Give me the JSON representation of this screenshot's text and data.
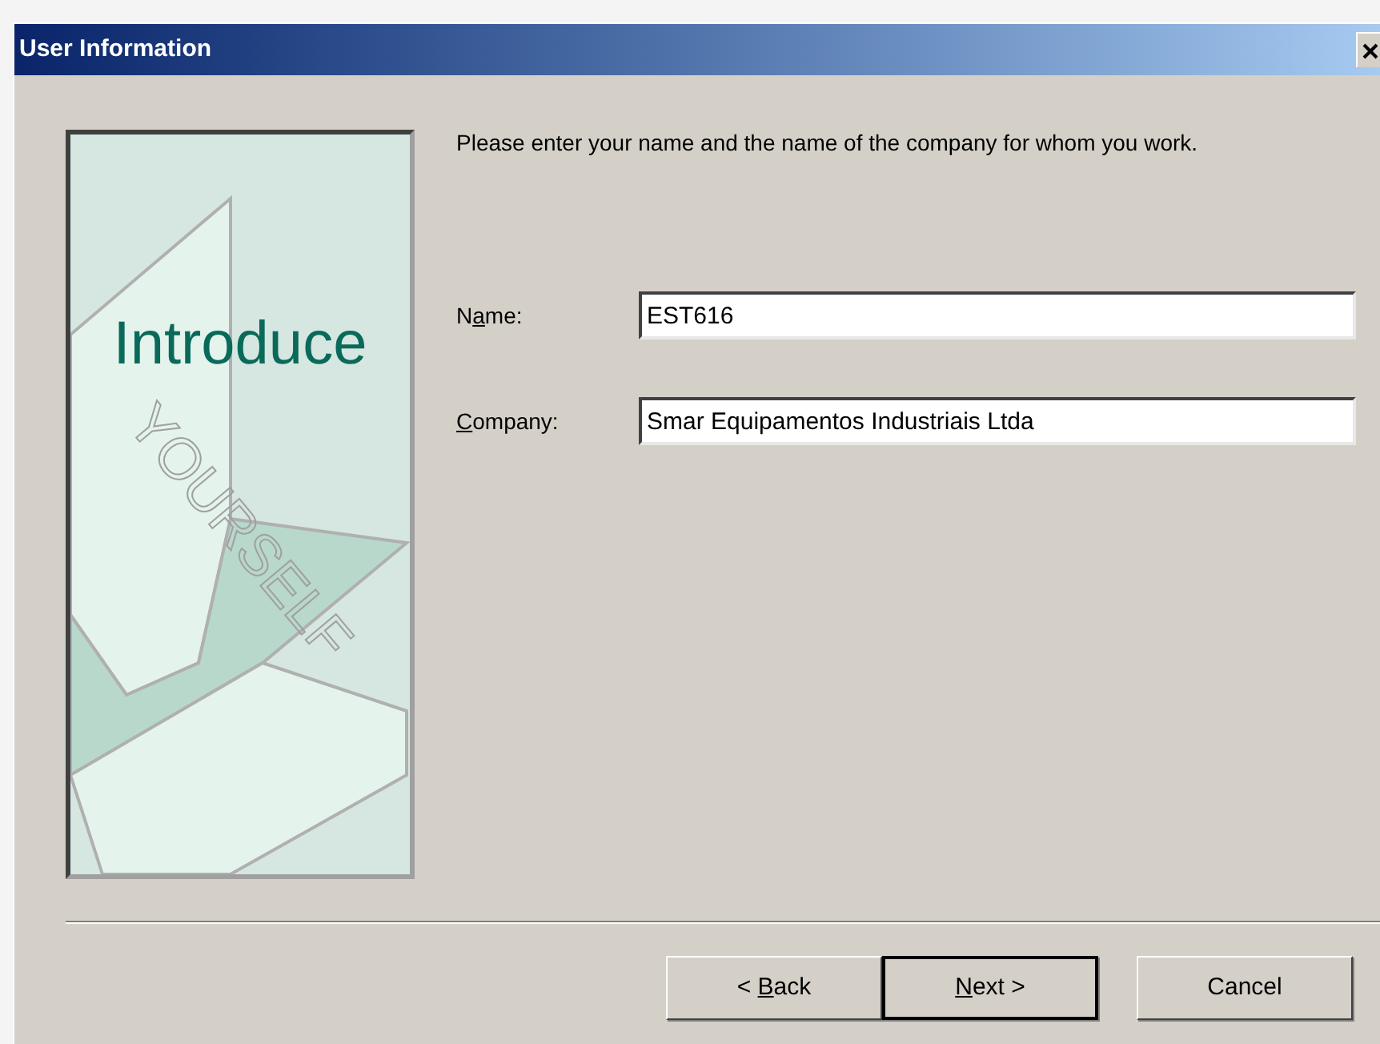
{
  "window": {
    "title": "User Information"
  },
  "banner": {
    "title": "Introduce",
    "subtitle": "YOURSELF"
  },
  "intro": "Please enter your name and the name of the company for whom you work.",
  "fields": [
    {
      "label": {
        "before": "N",
        "key": "a",
        "after": "me:"
      },
      "value": "EST616"
    },
    {
      "label": {
        "key": "C",
        "after": "ompany:"
      },
      "value": "Smar Equipamentos Industriais Ltda"
    }
  ],
  "buttons": [
    {
      "label": {
        "before": "< ",
        "key": "B",
        "after": "ack"
      },
      "default": false
    },
    {
      "label": {
        "key": "N",
        "after": "ext >"
      },
      "default": true
    },
    {
      "label": {
        "after": "Cancel"
      },
      "default": false
    }
  ]
}
